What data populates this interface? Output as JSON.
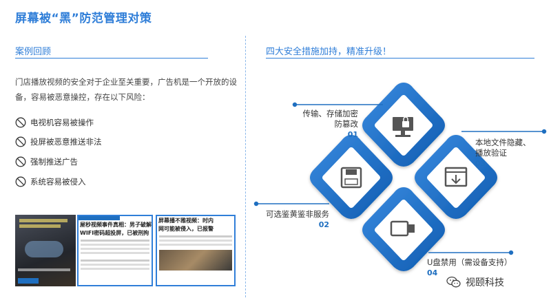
{
  "page": {
    "title": "屏幕被“黑”防范管理对策"
  },
  "left": {
    "section_title": "案例回顾",
    "intro": "门店播放视频的安全对于企业至关重要，广告机是一个开放的设备，容易被恶意操控，存在以下风险：",
    "risks": [
      "电视机容易被操作",
      "投屏被恶意推送非法",
      "强制推送广告",
      "系统容易被侵入"
    ],
    "news": [
      {
        "headline": "WIFI密码超投屏，已被刑拘",
        "headline_top": "屋秒视频事件真相：男子破解店内"
      },
      {
        "headline": "网可能被侵入，已报警",
        "headline_top": "屏幕播不雅视频：时内"
      }
    ]
  },
  "right": {
    "section_title": "四大安全措施加持，精准升级！",
    "measures": [
      {
        "label_line1": "传输、存储加密",
        "label_line2": "防篡改",
        "num": "01",
        "icon": "monitor-lock-icon"
      },
      {
        "label_line1": "可选鉴黄鉴非服务",
        "label_line2": "",
        "num": "02",
        "icon": "floppy-disk-icon"
      },
      {
        "label_line1": "本地文件隐藏、",
        "label_line2": "播放验证",
        "num": "03",
        "icon": "window-download-icon"
      },
      {
        "label_line1": "U盘禁用（需设备支持）",
        "label_line2": "",
        "num": "04",
        "icon": "usb-drive-icon"
      }
    ]
  },
  "footer": {
    "brand": "视颐科技"
  },
  "colors": {
    "accent": "#2f7ed8",
    "dark_blue": "#1f6fc0",
    "red_icon": "#c0392b"
  }
}
